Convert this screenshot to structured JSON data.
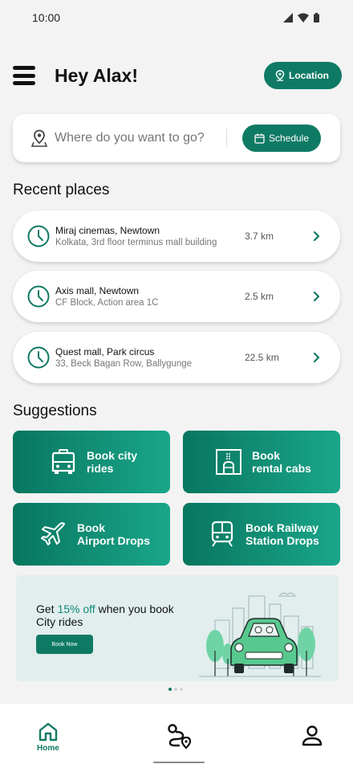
{
  "status_bar": {
    "time": "10:00",
    "icons": [
      "signal-icon",
      "wifi-icon",
      "battery-icon"
    ]
  },
  "header": {
    "greeting": "Hey Alax!",
    "location_label": "Location"
  },
  "search": {
    "placeholder": "Where do you want to go?",
    "schedule_label": "Schedule"
  },
  "recent": {
    "title": "Recent places",
    "items": [
      {
        "name": "Miraj cinemas, Newtown",
        "address": "Kolkata, 3rd floor terminus mall building",
        "distance": "3.7 km"
      },
      {
        "name": "Axis mall, Newtown",
        "address": "CF Block, Action area 1C",
        "distance": "2.5 km"
      },
      {
        "name": "Quest mall, Park circus",
        "address": "33, Beck Bagan Row, Ballygunge",
        "distance": "22.5 km"
      }
    ]
  },
  "suggestions": {
    "title": "Suggestions",
    "items": [
      {
        "label": "Book city\nrides",
        "icon": "taxi-icon"
      },
      {
        "label": "Book\nrental cabs",
        "icon": "building-icon"
      },
      {
        "label": "Book\nAirport Drops",
        "icon": "airplane-icon"
      },
      {
        "label": "Book Railway\nStation Drops",
        "icon": "train-icon"
      }
    ]
  },
  "promo": {
    "text_before": "Get ",
    "highlight": "15% off",
    "text_after": " when you book City rides",
    "button": "Book Now"
  },
  "carousel": {
    "pages": 3,
    "active": 1
  },
  "bottom_nav": {
    "home_label": "Home"
  },
  "colors": {
    "brand": "#0f7a64",
    "brand_light": "#1aa68a",
    "background": "#f3f3f3",
    "promo_bg": "#e2eeee"
  }
}
